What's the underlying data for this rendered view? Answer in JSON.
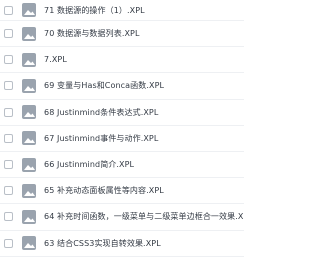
{
  "files": [
    {
      "name": "71 数据源的操作（1）.XPL",
      "icon": "image-file-icon"
    },
    {
      "name": "70 数据源与数据列表.XPL",
      "icon": "image-file-icon"
    },
    {
      "name": "7.XPL",
      "icon": "image-file-icon"
    },
    {
      "name": "69 变量与Has和Conca函数.XPL",
      "icon": "image-file-icon"
    },
    {
      "name": "68 Justinmind条件表达式.XPL",
      "icon": "image-file-icon"
    },
    {
      "name": "67 Justinmind事件与动作.XPL",
      "icon": "image-file-icon"
    },
    {
      "name": "66 Justinmind简介.XPL",
      "icon": "image-file-icon"
    },
    {
      "name": "65 补充动态面板属性等内容.XPL",
      "icon": "image-file-icon"
    },
    {
      "name": "64 补充时间函数，一级菜单与二级菜单边框合一效果.XPL",
      "icon": "image-file-icon"
    },
    {
      "name": "63 结合CSS3实现自转效果.XPL",
      "icon": "image-file-icon"
    }
  ],
  "colors": {
    "icon": "#9aa3ae",
    "text": "#333a44",
    "divider": "#eef0f3",
    "checkbox_border": "#b9bfc7"
  }
}
